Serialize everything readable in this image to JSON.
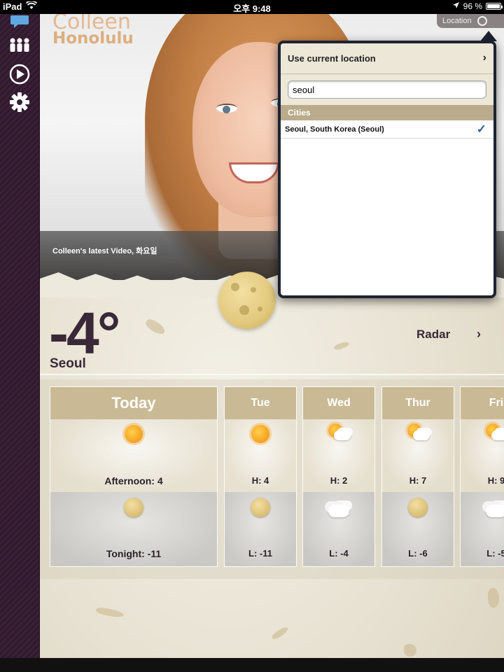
{
  "status_bar": {
    "device": "iPad",
    "time": "오후 9:48",
    "battery": "96 %"
  },
  "hero": {
    "title": "Colleen",
    "subtitle": "Honolulu",
    "video_caption": "Colleen's latest Video, 화요일"
  },
  "location_button": {
    "label": "Location"
  },
  "current": {
    "temperature": "-4°",
    "city": "Seoul",
    "radar_label": "Radar"
  },
  "popover": {
    "use_current_location": "Use current location",
    "search_value": "seoul",
    "section_header": "Cities",
    "results": [
      {
        "name": "Seoul, South Korea (Seoul)",
        "selected": true
      }
    ]
  },
  "forecast": {
    "days": [
      {
        "name": "Today",
        "day_icon": "sun-icon",
        "day_text": "Afternoon: 4",
        "night_icon": "moon-icon",
        "night_text": "Tonight: -11"
      },
      {
        "name": "Tue",
        "day_icon": "sun-icon",
        "day_text": "H: 4",
        "night_icon": "moon-icon",
        "night_text": "L: -11"
      },
      {
        "name": "Wed",
        "day_icon": "partly-cloudy-icon",
        "day_text": "H: 2",
        "night_icon": "cloud-icon",
        "night_text": "L: -4"
      },
      {
        "name": "Thur",
        "day_icon": "partly-cloudy-icon",
        "day_text": "H: 7",
        "night_icon": "moon-icon",
        "night_text": "L: -6"
      },
      {
        "name": "Fri",
        "day_icon": "partly-cloudy-icon",
        "day_text": "H: 9",
        "night_icon": "cloud-icon",
        "night_text": "L: -5"
      }
    ]
  },
  "colors": {
    "sidebar": "#3b2038",
    "text_dark": "#3a2838",
    "forecast_header": "#c9b994",
    "popover_frame": "#1d2330",
    "check": "#3b5c9e"
  }
}
